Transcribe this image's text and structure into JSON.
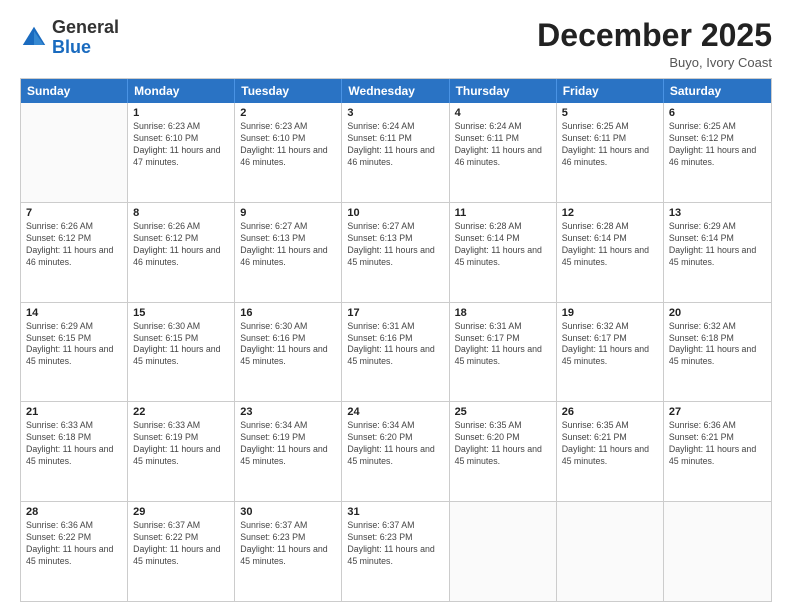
{
  "header": {
    "logo": {
      "general": "General",
      "blue": "Blue"
    },
    "month_year": "December 2025",
    "location": "Buyo, Ivory Coast"
  },
  "weekdays": [
    "Sunday",
    "Monday",
    "Tuesday",
    "Wednesday",
    "Thursday",
    "Friday",
    "Saturday"
  ],
  "weeks": [
    [
      {
        "day": "",
        "empty": true
      },
      {
        "day": "1",
        "sunrise": "Sunrise: 6:23 AM",
        "sunset": "Sunset: 6:10 PM",
        "daylight": "Daylight: 11 hours and 47 minutes."
      },
      {
        "day": "2",
        "sunrise": "Sunrise: 6:23 AM",
        "sunset": "Sunset: 6:10 PM",
        "daylight": "Daylight: 11 hours and 46 minutes."
      },
      {
        "day": "3",
        "sunrise": "Sunrise: 6:24 AM",
        "sunset": "Sunset: 6:11 PM",
        "daylight": "Daylight: 11 hours and 46 minutes."
      },
      {
        "day": "4",
        "sunrise": "Sunrise: 6:24 AM",
        "sunset": "Sunset: 6:11 PM",
        "daylight": "Daylight: 11 hours and 46 minutes."
      },
      {
        "day": "5",
        "sunrise": "Sunrise: 6:25 AM",
        "sunset": "Sunset: 6:11 PM",
        "daylight": "Daylight: 11 hours and 46 minutes."
      },
      {
        "day": "6",
        "sunrise": "Sunrise: 6:25 AM",
        "sunset": "Sunset: 6:12 PM",
        "daylight": "Daylight: 11 hours and 46 minutes."
      }
    ],
    [
      {
        "day": "7",
        "sunrise": "Sunrise: 6:26 AM",
        "sunset": "Sunset: 6:12 PM",
        "daylight": "Daylight: 11 hours and 46 minutes."
      },
      {
        "day": "8",
        "sunrise": "Sunrise: 6:26 AM",
        "sunset": "Sunset: 6:12 PM",
        "daylight": "Daylight: 11 hours and 46 minutes."
      },
      {
        "day": "9",
        "sunrise": "Sunrise: 6:27 AM",
        "sunset": "Sunset: 6:13 PM",
        "daylight": "Daylight: 11 hours and 46 minutes."
      },
      {
        "day": "10",
        "sunrise": "Sunrise: 6:27 AM",
        "sunset": "Sunset: 6:13 PM",
        "daylight": "Daylight: 11 hours and 45 minutes."
      },
      {
        "day": "11",
        "sunrise": "Sunrise: 6:28 AM",
        "sunset": "Sunset: 6:14 PM",
        "daylight": "Daylight: 11 hours and 45 minutes."
      },
      {
        "day": "12",
        "sunrise": "Sunrise: 6:28 AM",
        "sunset": "Sunset: 6:14 PM",
        "daylight": "Daylight: 11 hours and 45 minutes."
      },
      {
        "day": "13",
        "sunrise": "Sunrise: 6:29 AM",
        "sunset": "Sunset: 6:14 PM",
        "daylight": "Daylight: 11 hours and 45 minutes."
      }
    ],
    [
      {
        "day": "14",
        "sunrise": "Sunrise: 6:29 AM",
        "sunset": "Sunset: 6:15 PM",
        "daylight": "Daylight: 11 hours and 45 minutes."
      },
      {
        "day": "15",
        "sunrise": "Sunrise: 6:30 AM",
        "sunset": "Sunset: 6:15 PM",
        "daylight": "Daylight: 11 hours and 45 minutes."
      },
      {
        "day": "16",
        "sunrise": "Sunrise: 6:30 AM",
        "sunset": "Sunset: 6:16 PM",
        "daylight": "Daylight: 11 hours and 45 minutes."
      },
      {
        "day": "17",
        "sunrise": "Sunrise: 6:31 AM",
        "sunset": "Sunset: 6:16 PM",
        "daylight": "Daylight: 11 hours and 45 minutes."
      },
      {
        "day": "18",
        "sunrise": "Sunrise: 6:31 AM",
        "sunset": "Sunset: 6:17 PM",
        "daylight": "Daylight: 11 hours and 45 minutes."
      },
      {
        "day": "19",
        "sunrise": "Sunrise: 6:32 AM",
        "sunset": "Sunset: 6:17 PM",
        "daylight": "Daylight: 11 hours and 45 minutes."
      },
      {
        "day": "20",
        "sunrise": "Sunrise: 6:32 AM",
        "sunset": "Sunset: 6:18 PM",
        "daylight": "Daylight: 11 hours and 45 minutes."
      }
    ],
    [
      {
        "day": "21",
        "sunrise": "Sunrise: 6:33 AM",
        "sunset": "Sunset: 6:18 PM",
        "daylight": "Daylight: 11 hours and 45 minutes."
      },
      {
        "day": "22",
        "sunrise": "Sunrise: 6:33 AM",
        "sunset": "Sunset: 6:19 PM",
        "daylight": "Daylight: 11 hours and 45 minutes."
      },
      {
        "day": "23",
        "sunrise": "Sunrise: 6:34 AM",
        "sunset": "Sunset: 6:19 PM",
        "daylight": "Daylight: 11 hours and 45 minutes."
      },
      {
        "day": "24",
        "sunrise": "Sunrise: 6:34 AM",
        "sunset": "Sunset: 6:20 PM",
        "daylight": "Daylight: 11 hours and 45 minutes."
      },
      {
        "day": "25",
        "sunrise": "Sunrise: 6:35 AM",
        "sunset": "Sunset: 6:20 PM",
        "daylight": "Daylight: 11 hours and 45 minutes."
      },
      {
        "day": "26",
        "sunrise": "Sunrise: 6:35 AM",
        "sunset": "Sunset: 6:21 PM",
        "daylight": "Daylight: 11 hours and 45 minutes."
      },
      {
        "day": "27",
        "sunrise": "Sunrise: 6:36 AM",
        "sunset": "Sunset: 6:21 PM",
        "daylight": "Daylight: 11 hours and 45 minutes."
      }
    ],
    [
      {
        "day": "28",
        "sunrise": "Sunrise: 6:36 AM",
        "sunset": "Sunset: 6:22 PM",
        "daylight": "Daylight: 11 hours and 45 minutes."
      },
      {
        "day": "29",
        "sunrise": "Sunrise: 6:37 AM",
        "sunset": "Sunset: 6:22 PM",
        "daylight": "Daylight: 11 hours and 45 minutes."
      },
      {
        "day": "30",
        "sunrise": "Sunrise: 6:37 AM",
        "sunset": "Sunset: 6:23 PM",
        "daylight": "Daylight: 11 hours and 45 minutes."
      },
      {
        "day": "31",
        "sunrise": "Sunrise: 6:37 AM",
        "sunset": "Sunset: 6:23 PM",
        "daylight": "Daylight: 11 hours and 45 minutes."
      },
      {
        "day": "",
        "empty": true
      },
      {
        "day": "",
        "empty": true
      },
      {
        "day": "",
        "empty": true
      }
    ]
  ]
}
